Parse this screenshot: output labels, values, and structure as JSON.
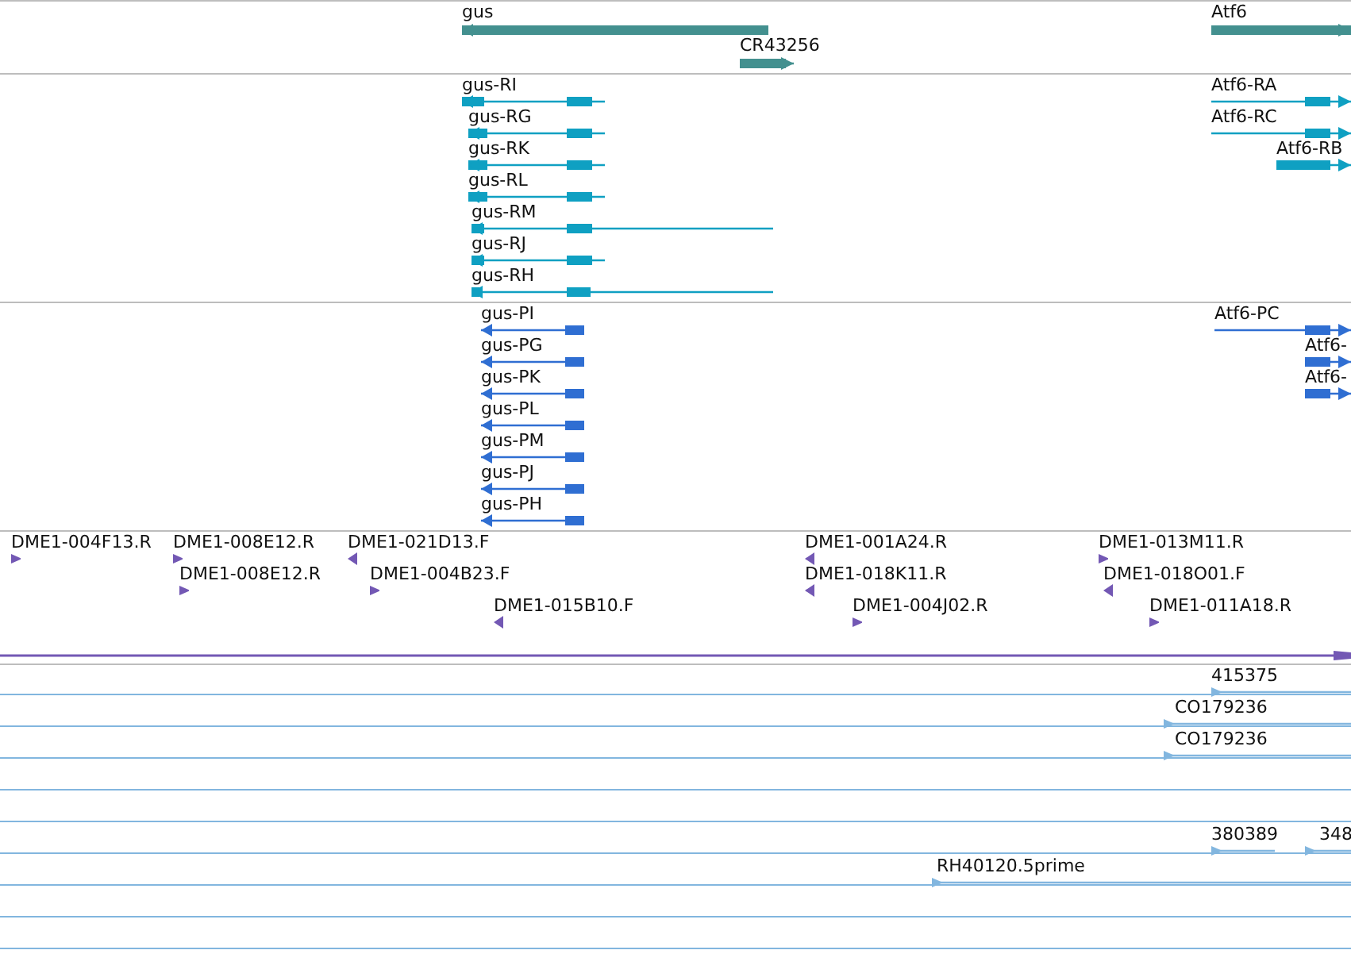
{
  "tracks": [
    {
      "kind": "gene",
      "features": [
        {
          "label": "gus",
          "reverse": true
        },
        {
          "label": "CR43256",
          "reverse": false
        },
        {
          "label": "Atf6",
          "reverse": false
        }
      ]
    },
    {
      "kind": "transcript",
      "features": [
        {
          "label": "gus-RI",
          "reverse": true
        },
        {
          "label": "gus-RG",
          "reverse": true
        },
        {
          "label": "gus-RK",
          "reverse": true
        },
        {
          "label": "gus-RL",
          "reverse": true
        },
        {
          "label": "gus-RM",
          "reverse": true
        },
        {
          "label": "gus-RJ",
          "reverse": true
        },
        {
          "label": "gus-RH",
          "reverse": true
        },
        {
          "label": "Atf6-RA",
          "reverse": false
        },
        {
          "label": "Atf6-RC",
          "reverse": false
        },
        {
          "label": "Atf6-RB",
          "reverse": false
        }
      ]
    },
    {
      "kind": "protein",
      "features": [
        {
          "label": "gus-PI",
          "reverse": true
        },
        {
          "label": "gus-PG",
          "reverse": true
        },
        {
          "label": "gus-PK",
          "reverse": true
        },
        {
          "label": "gus-PL",
          "reverse": true
        },
        {
          "label": "gus-PM",
          "reverse": true
        },
        {
          "label": "gus-PJ",
          "reverse": true
        },
        {
          "label": "gus-PH",
          "reverse": true
        },
        {
          "label": "Atf6-PC",
          "reverse": false
        },
        {
          "label": "Atf6-",
          "reverse": false
        },
        {
          "label": "Atf6-",
          "reverse": false
        }
      ]
    },
    {
      "kind": "clone",
      "features": [
        {
          "label": "DME1-004F13.R",
          "reverse": false
        },
        {
          "label": "DME1-008E12.R",
          "reverse": false
        },
        {
          "label": "DME1-021D13.F",
          "reverse": true
        },
        {
          "label": "DME1-008E12.R",
          "reverse": false
        },
        {
          "label": "DME1-004B23.F",
          "reverse": false
        },
        {
          "label": "DME1-015B10.F",
          "reverse": true
        },
        {
          "label": "DME1-001A24.R",
          "reverse": true
        },
        {
          "label": "DME1-018K11.R",
          "reverse": true
        },
        {
          "label": "DME1-004J02.R",
          "reverse": false
        },
        {
          "label": "DME1-013M11.R",
          "reverse": false
        },
        {
          "label": "DME1-018O01.F",
          "reverse": true
        },
        {
          "label": "DME1-011A18.R",
          "reverse": false
        }
      ]
    },
    {
      "kind": "est",
      "features": [
        {
          "label": "415375",
          "reverse": false
        },
        {
          "label": "CO179236",
          "reverse": false
        },
        {
          "label": "CO179236",
          "reverse": false
        },
        {
          "label": "380389",
          "reverse": false
        },
        {
          "label": "348",
          "reverse": false
        },
        {
          "label": "RH40120.5prime",
          "reverse": false
        }
      ]
    }
  ]
}
